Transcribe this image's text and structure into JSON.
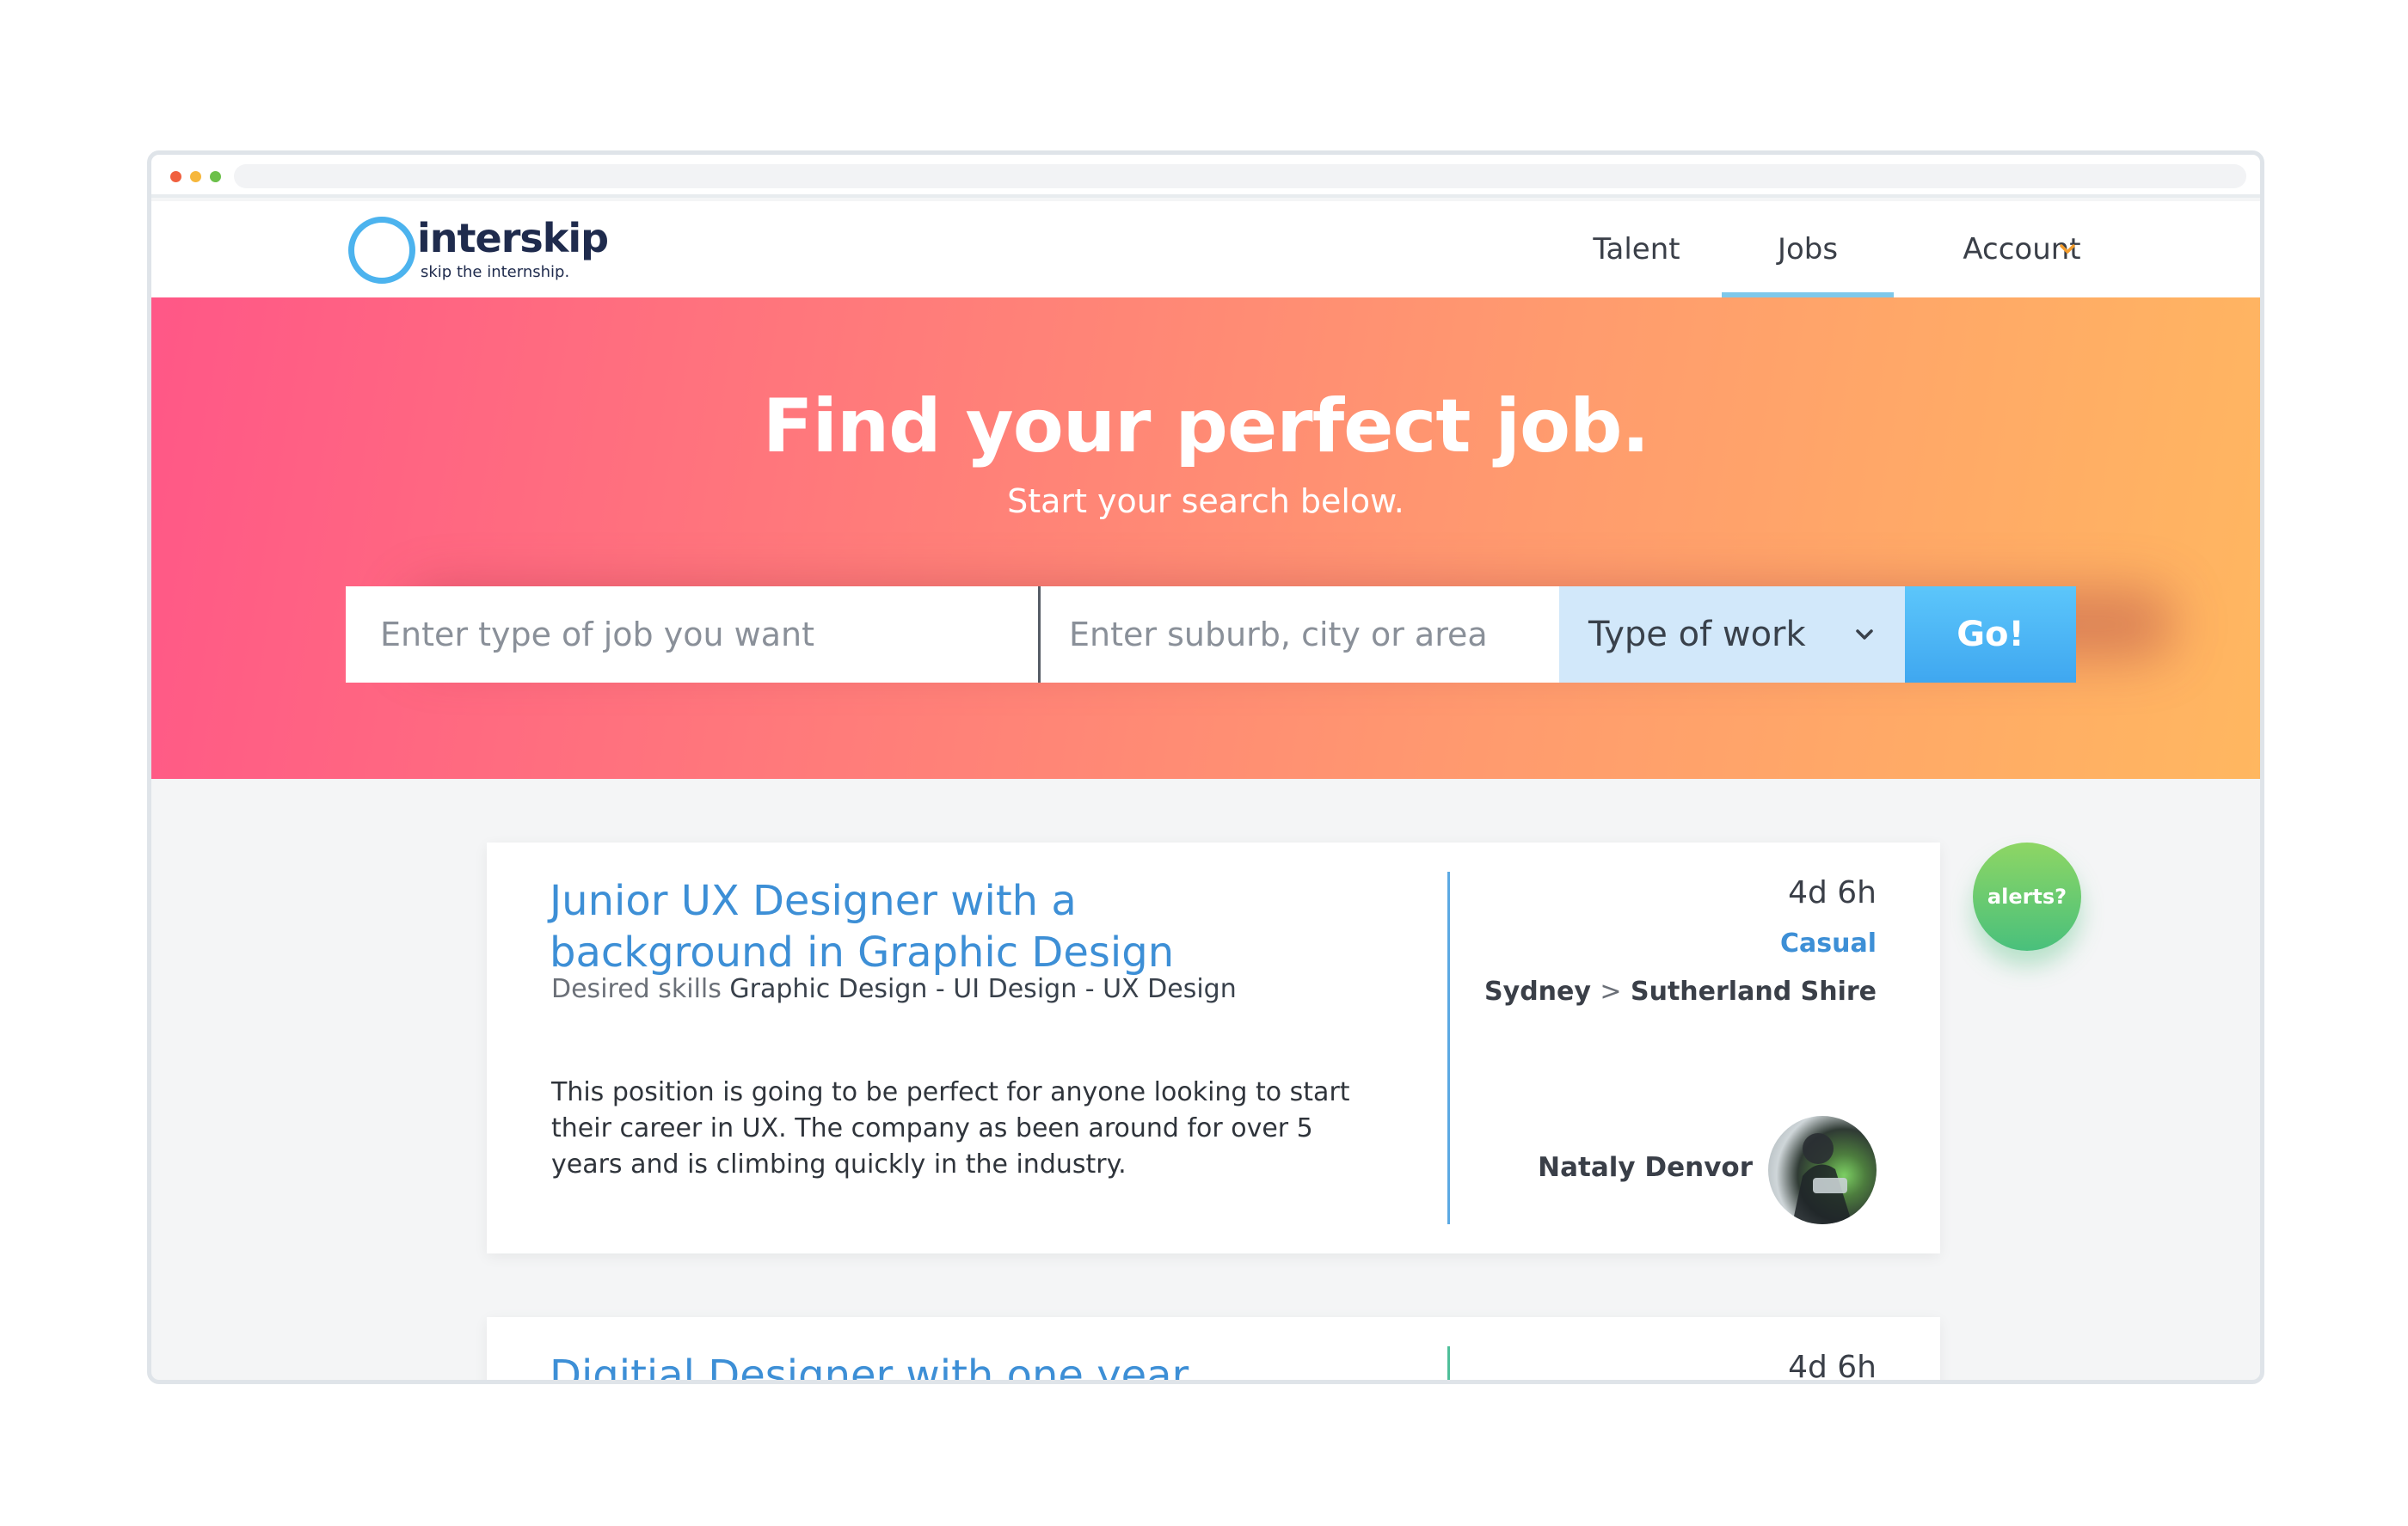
{
  "colors": {
    "brand_blue": "#4cb3ee",
    "link_blue": "#3d8fd6",
    "hero_gradient_start": "#ff5787",
    "hero_gradient_end": "#ffb760",
    "go_button": "#3fa7f0",
    "alerts_green": "#49c07c"
  },
  "brand": {
    "name": "interskip",
    "tagline": "skip the internship."
  },
  "nav": {
    "talent": "Talent",
    "jobs": "Jobs",
    "account": "Account",
    "active": "Jobs",
    "account_icon": "chevron-down-icon"
  },
  "hero": {
    "title": "Find your perfect job.",
    "subtitle": "Start your search below."
  },
  "search": {
    "job_placeholder": "Enter type of job you want",
    "location_placeholder": "Enter suburb, city or area",
    "type_of_work": "Type of work",
    "go_label": "Go!"
  },
  "alerts": {
    "label": "alerts?"
  },
  "listings": [
    {
      "title": "Junior UX Designer with a background in Graphic Design",
      "skills_label": "Desired skills",
      "skills": "Graphic Design - UI Design - UX Design",
      "description": "This position is going to be perfect for anyone looking to start their career in UX. The company as been around for over 5 years and is climbing quickly in the industry.",
      "posted": "4d 6h",
      "work_type": "Casual",
      "city": "Sydney",
      "separator": ">",
      "area": "Sutherland Shire",
      "contact": "Nataly Denvor"
    },
    {
      "title": "Digitial Designer with one year",
      "posted": "4d 6h"
    }
  ]
}
